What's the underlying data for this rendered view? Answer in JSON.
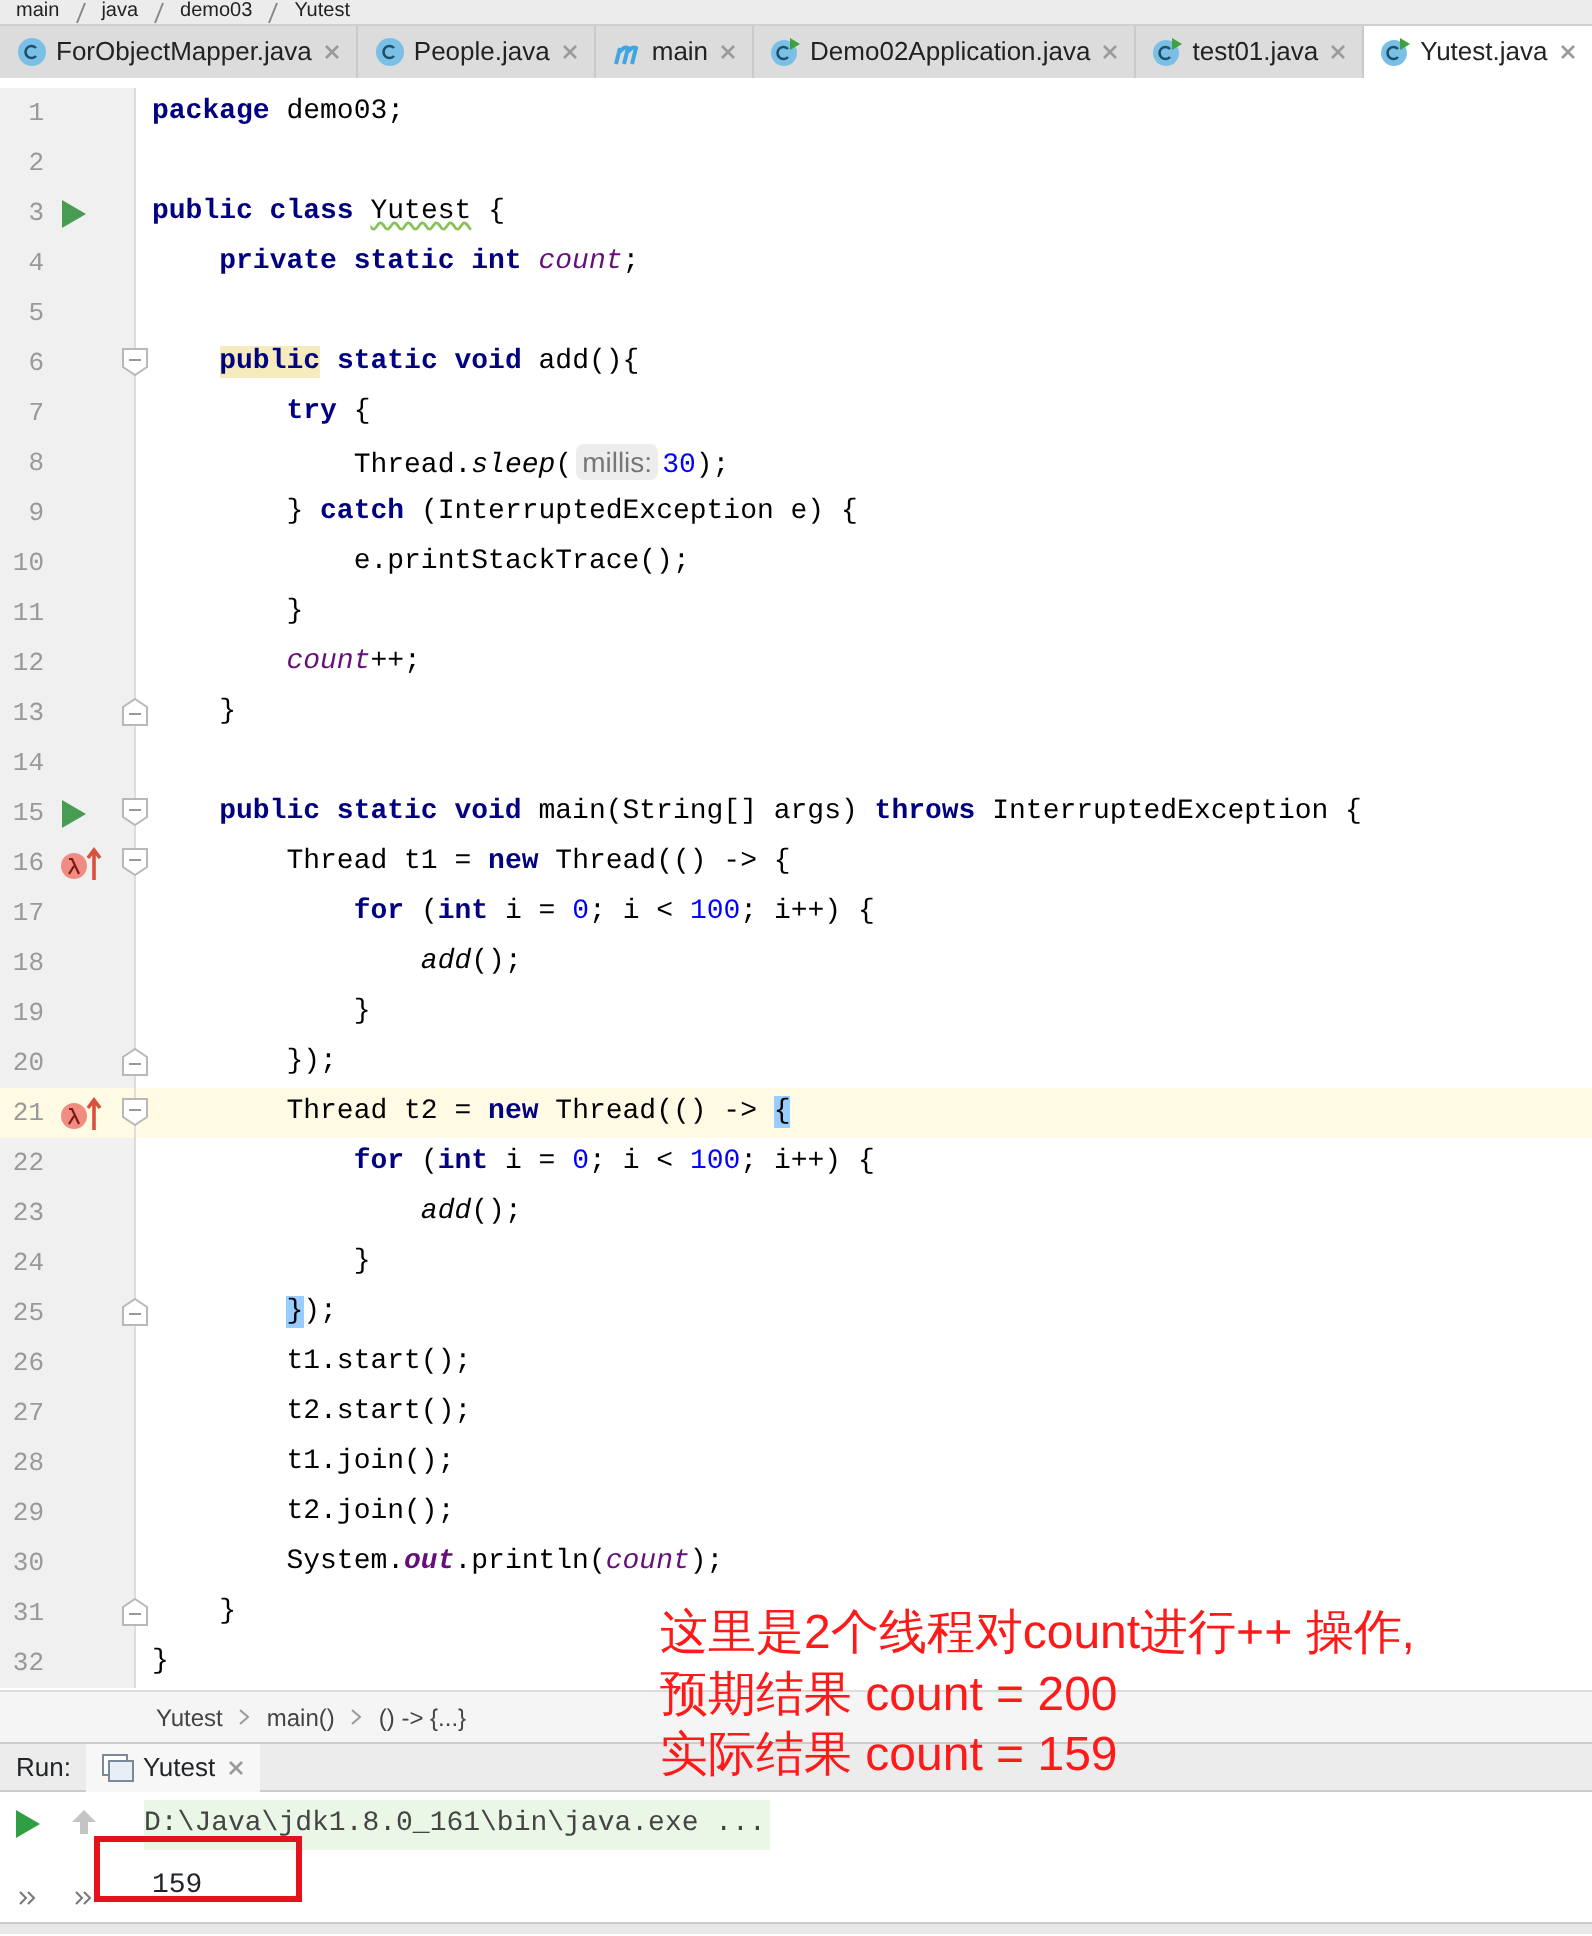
{
  "nav_path": [
    "main",
    "java",
    "demo03",
    "Yutest"
  ],
  "tabs": [
    {
      "label": "ForObjectMapper.java",
      "kind": "class",
      "selected": false
    },
    {
      "label": "People.java",
      "kind": "class",
      "selected": false
    },
    {
      "label": "main",
      "kind": "module",
      "selected": false
    },
    {
      "label": "Demo02Application.java",
      "kind": "runnable",
      "selected": false
    },
    {
      "label": "test01.java",
      "kind": "runnable",
      "selected": false
    },
    {
      "label": "Yutest.java",
      "kind": "runnable",
      "selected": true
    }
  ],
  "editor": {
    "lines": [
      {
        "number": "1",
        "tokens": [
          {
            "kind": "kw",
            "text": "package"
          },
          {
            "kind": "t",
            "text": " demo03;"
          }
        ]
      },
      {
        "number": "2"
      },
      {
        "number": "3",
        "run": true,
        "tokens": [
          {
            "kind": "kw",
            "text": "public class"
          },
          {
            "kind": "warn",
            "text": " Yutest"
          },
          {
            "kind": "t",
            "text": " {"
          }
        ]
      },
      {
        "number": "4",
        "tokens": [
          {
            "kind": "kw",
            "text": "    private static int"
          },
          {
            "kind": "field",
            "text": " count"
          },
          {
            "kind": "t",
            "text": ";"
          }
        ]
      },
      {
        "number": "5"
      },
      {
        "number": "6",
        "fold_start": true,
        "tokens": [
          {
            "kind": "kwmark",
            "text": "    public"
          },
          {
            "kind": "kw",
            "text": " static void"
          },
          {
            "kind": "t",
            "text": " add(){"
          }
        ]
      },
      {
        "number": "7",
        "tokens": [
          {
            "kind": "kw",
            "text": "        try"
          },
          {
            "kind": "t",
            "text": " {"
          }
        ]
      },
      {
        "number": "8",
        "tokens": [
          {
            "kind": "t",
            "text": "            Thread."
          },
          {
            "kind": "call",
            "text": "sleep"
          },
          {
            "kind": "t",
            "text": "("
          },
          {
            "kind": "hint",
            "text": "millis:"
          },
          {
            "kind": "num",
            "text": "30"
          },
          {
            "kind": "t",
            "text": ");"
          }
        ]
      },
      {
        "number": "9",
        "tokens": [
          {
            "kind": "t",
            "text": "        }"
          },
          {
            "kind": "kw",
            "text": " catch"
          },
          {
            "kind": "t",
            "text": " (InterruptedException e) {"
          }
        ]
      },
      {
        "number": "10",
        "tokens": [
          {
            "kind": "t",
            "text": "            e.printStackTrace();"
          }
        ]
      },
      {
        "number": "11",
        "tokens": [
          {
            "kind": "t",
            "text": "        }"
          }
        ]
      },
      {
        "number": "12",
        "tokens": [
          {
            "kind": "field",
            "text": "        count"
          },
          {
            "kind": "t",
            "text": "++;"
          }
        ]
      },
      {
        "number": "13",
        "fold_end": true,
        "tokens": [
          {
            "kind": "t",
            "text": "    }"
          }
        ]
      },
      {
        "number": "14"
      },
      {
        "number": "15",
        "run": true,
        "fold_start": true,
        "tokens": [
          {
            "kind": "kw",
            "text": "    public static void"
          },
          {
            "kind": "t",
            "text": " main(String[] args)"
          },
          {
            "kind": "kw",
            "text": " throws"
          },
          {
            "kind": "t",
            "text": " InterruptedException {"
          }
        ]
      },
      {
        "number": "16",
        "lambda": true,
        "fold_start": true,
        "tokens": [
          {
            "kind": "t",
            "text": "        Thread t1 ="
          },
          {
            "kind": "kw",
            "text": " new"
          },
          {
            "kind": "t",
            "text": " Thread(() -> {"
          }
        ]
      },
      {
        "number": "17",
        "tokens": [
          {
            "kind": "kw",
            "text": "            for"
          },
          {
            "kind": "t",
            "text": " ("
          },
          {
            "kind": "kw",
            "text": "int"
          },
          {
            "kind": "t",
            "text": " i ="
          },
          {
            "kind": "num",
            "text": " 0"
          },
          {
            "kind": "t",
            "text": "; i <"
          },
          {
            "kind": "num",
            "text": " 100"
          },
          {
            "kind": "t",
            "text": "; i++) {"
          }
        ]
      },
      {
        "number": "18",
        "tokens": [
          {
            "kind": "call",
            "text": "                add"
          },
          {
            "kind": "t",
            "text": "();"
          }
        ]
      },
      {
        "number": "19",
        "tokens": [
          {
            "kind": "t",
            "text": "            }"
          }
        ]
      },
      {
        "number": "20",
        "fold_end": true,
        "tokens": [
          {
            "kind": "t",
            "text": "        });"
          }
        ]
      },
      {
        "number": "21",
        "current": true,
        "lambda": true,
        "fold_start": true,
        "tokens": [
          {
            "kind": "t",
            "text": "        Thread t2 ="
          },
          {
            "kind": "kw",
            "text": " new"
          },
          {
            "kind": "t",
            "text": " Thread(() ->"
          },
          {
            "kind": "brace",
            "text": " {"
          }
        ]
      },
      {
        "number": "22",
        "tokens": [
          {
            "kind": "kw",
            "text": "            for"
          },
          {
            "kind": "t",
            "text": " ("
          },
          {
            "kind": "kw",
            "text": "int"
          },
          {
            "kind": "t",
            "text": " i ="
          },
          {
            "kind": "num",
            "text": " 0"
          },
          {
            "kind": "t",
            "text": "; i <"
          },
          {
            "kind": "num",
            "text": " 100"
          },
          {
            "kind": "t",
            "text": "; i++) {"
          }
        ]
      },
      {
        "number": "23",
        "tokens": [
          {
            "kind": "call",
            "text": "                add"
          },
          {
            "kind": "t",
            "text": "();"
          }
        ]
      },
      {
        "number": "24",
        "tokens": [
          {
            "kind": "t",
            "text": "            }"
          }
        ]
      },
      {
        "number": "25",
        "fold_end": true,
        "tokens": [
          {
            "kind": "brace",
            "text": "        }"
          },
          {
            "kind": "t",
            "text": ");"
          }
        ]
      },
      {
        "number": "26",
        "tokens": [
          {
            "kind": "t",
            "text": "        t1.start();"
          }
        ]
      },
      {
        "number": "27",
        "tokens": [
          {
            "kind": "t",
            "text": "        t2.start();"
          }
        ]
      },
      {
        "number": "28",
        "tokens": [
          {
            "kind": "t",
            "text": "        t1.join();"
          }
        ]
      },
      {
        "number": "29",
        "tokens": [
          {
            "kind": "t",
            "text": "        t2.join();"
          }
        ]
      },
      {
        "number": "30",
        "tokens": [
          {
            "kind": "t",
            "text": "        System."
          },
          {
            "kind": "sfield",
            "text": "out"
          },
          {
            "kind": "t",
            "text": ".println("
          },
          {
            "kind": "field",
            "text": "count"
          },
          {
            "kind": "t",
            "text": ");"
          }
        ]
      },
      {
        "number": "31",
        "fold_end": true,
        "tokens": [
          {
            "kind": "t",
            "text": "    }"
          }
        ]
      },
      {
        "number": "32",
        "tokens": [
          {
            "kind": "t",
            "text": "}"
          }
        ]
      }
    ]
  },
  "annotation": [
    "这里是2个线程对count进行++ 操作,",
    "预期结果 count = 200",
    "实际结果 count = 159"
  ],
  "breadcrumbs": [
    "Yutest",
    "main()",
    "() -> {...}"
  ],
  "run_panel": {
    "label": "Run:",
    "tab": "Yutest",
    "command": "D:\\Java\\jdk1.8.0_161\\bin\\java.exe ...",
    "output": "159"
  }
}
